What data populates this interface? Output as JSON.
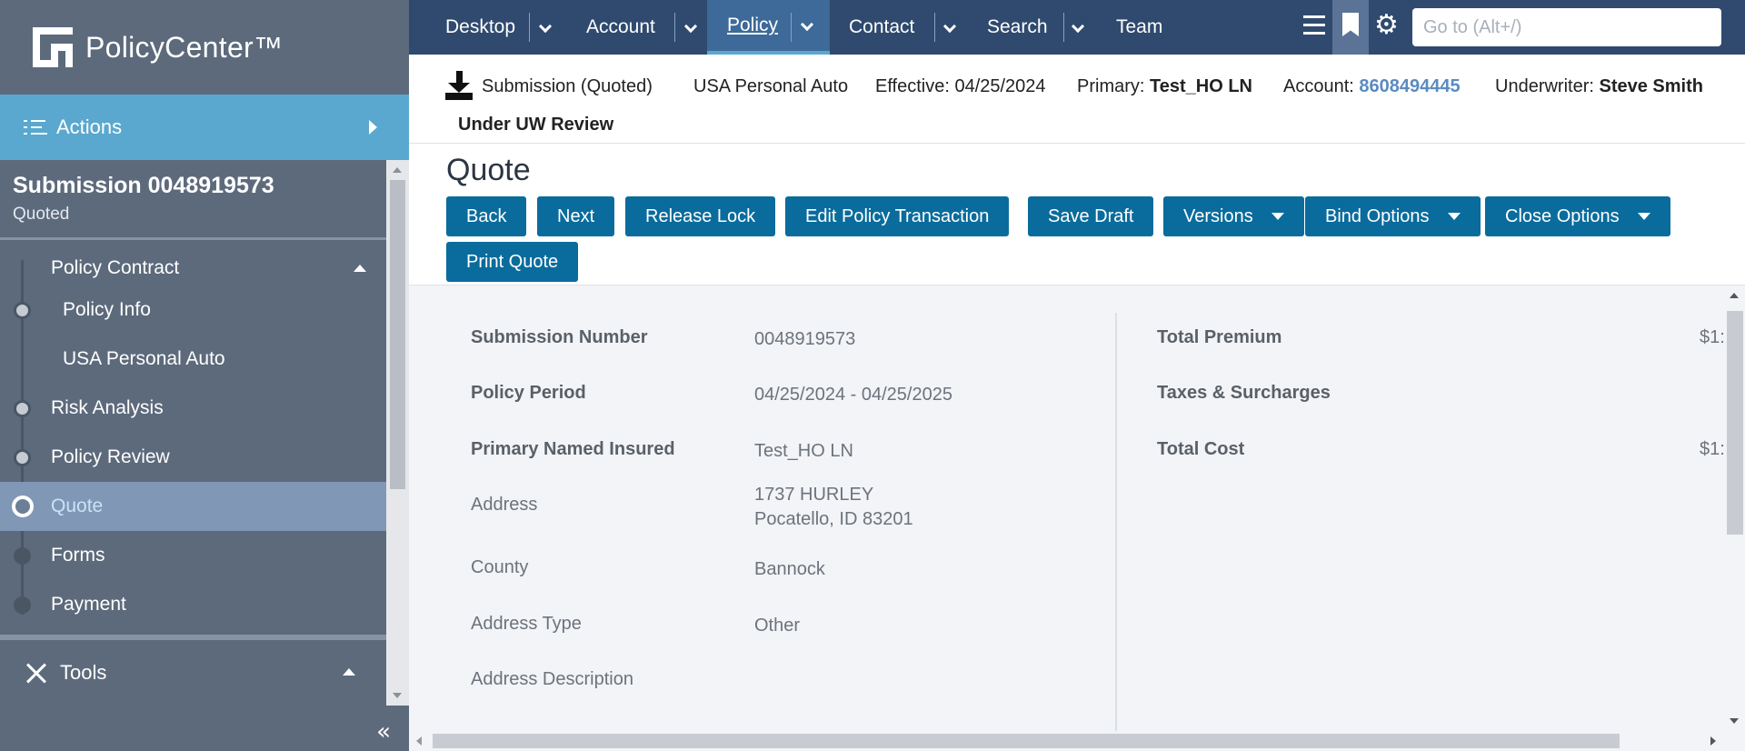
{
  "app": {
    "name": "PolicyCenter™"
  },
  "sidebar": {
    "actions_label": "Actions",
    "submission_title": "Submission 0048919573",
    "submission_status": "Quoted",
    "steps": [
      {
        "label": "Policy Contract"
      },
      {
        "label": "Policy Info"
      },
      {
        "label": "USA Personal Auto"
      },
      {
        "label": "Risk Analysis"
      },
      {
        "label": "Policy Review"
      },
      {
        "label": "Quote"
      },
      {
        "label": "Forms"
      },
      {
        "label": "Payment"
      }
    ],
    "tools_label": "Tools"
  },
  "topnav": {
    "tabs": [
      {
        "label": "Desktop"
      },
      {
        "label": "Account"
      },
      {
        "label": "Policy"
      },
      {
        "label": "Contact"
      },
      {
        "label": "Search"
      },
      {
        "label": "Team"
      }
    ],
    "goto_placeholder": "Go to (Alt+/)"
  },
  "infobar": {
    "job": "Submission (Quoted)",
    "product": "USA Personal Auto",
    "effective": "Effective: 04/25/2024",
    "primary_label": "Primary:",
    "primary_value": "Test_HO LN",
    "account_label": "Account:",
    "account_value": "8608494445",
    "underwriter_label": "Underwriter:",
    "underwriter_value": "Steve Smith",
    "review_status": "Under UW Review"
  },
  "toolbar": {
    "title": "Quote",
    "buttons": {
      "back": "Back",
      "next": "Next",
      "release_lock": "Release Lock",
      "edit_policy_transaction": "Edit Policy Transaction",
      "save_draft": "Save Draft",
      "versions": "Versions",
      "bind_options": "Bind Options",
      "close_options": "Close Options",
      "print_quote": "Print Quote"
    }
  },
  "details": {
    "left": [
      {
        "label": "Submission Number",
        "value": "0048919573"
      },
      {
        "label": "Policy Period",
        "value": "04/25/2024 - 04/25/2025"
      },
      {
        "label": "Primary Named Insured",
        "value": "Test_HO LN"
      },
      {
        "label": "Address",
        "value": "1737 HURLEY",
        "value2": "Pocatello, ID 83201"
      },
      {
        "label": "County",
        "value": "Bannock"
      },
      {
        "label": "Address Type",
        "value": "Other"
      },
      {
        "label": "Address Description",
        "value": ""
      }
    ],
    "right": [
      {
        "label": "Total Premium",
        "value": "$1:"
      },
      {
        "label": "Taxes & Surcharges",
        "value": ""
      },
      {
        "label": "Total Cost",
        "value": "$1:"
      }
    ]
  }
}
